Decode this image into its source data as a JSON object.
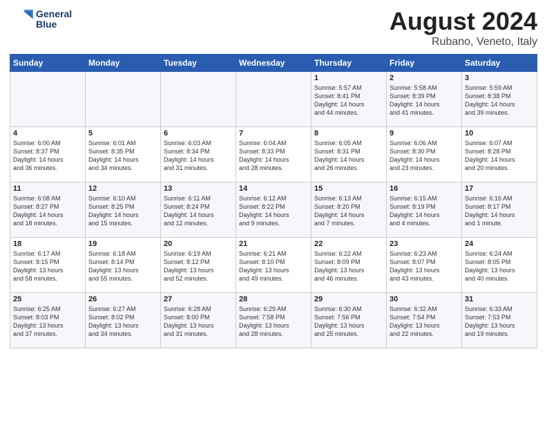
{
  "header": {
    "logo_line1": "General",
    "logo_line2": "Blue",
    "title": "August 2024",
    "subtitle": "Rubano, Veneto, Italy"
  },
  "days_of_week": [
    "Sunday",
    "Monday",
    "Tuesday",
    "Wednesday",
    "Thursday",
    "Friday",
    "Saturday"
  ],
  "weeks": [
    [
      {
        "day": "",
        "info": ""
      },
      {
        "day": "",
        "info": ""
      },
      {
        "day": "",
        "info": ""
      },
      {
        "day": "",
        "info": ""
      },
      {
        "day": "1",
        "info": "Sunrise: 5:57 AM\nSunset: 8:41 PM\nDaylight: 14 hours\nand 44 minutes."
      },
      {
        "day": "2",
        "info": "Sunrise: 5:58 AM\nSunset: 8:39 PM\nDaylight: 14 hours\nand 41 minutes."
      },
      {
        "day": "3",
        "info": "Sunrise: 5:59 AM\nSunset: 8:38 PM\nDaylight: 14 hours\nand 39 minutes."
      }
    ],
    [
      {
        "day": "4",
        "info": "Sunrise: 6:00 AM\nSunset: 8:37 PM\nDaylight: 14 hours\nand 36 minutes."
      },
      {
        "day": "5",
        "info": "Sunrise: 6:01 AM\nSunset: 8:35 PM\nDaylight: 14 hours\nand 34 minutes."
      },
      {
        "day": "6",
        "info": "Sunrise: 6:03 AM\nSunset: 8:34 PM\nDaylight: 14 hours\nand 31 minutes."
      },
      {
        "day": "7",
        "info": "Sunrise: 6:04 AM\nSunset: 8:33 PM\nDaylight: 14 hours\nand 28 minutes."
      },
      {
        "day": "8",
        "info": "Sunrise: 6:05 AM\nSunset: 8:31 PM\nDaylight: 14 hours\nand 26 minutes."
      },
      {
        "day": "9",
        "info": "Sunrise: 6:06 AM\nSunset: 8:30 PM\nDaylight: 14 hours\nand 23 minutes."
      },
      {
        "day": "10",
        "info": "Sunrise: 6:07 AM\nSunset: 8:28 PM\nDaylight: 14 hours\nand 20 minutes."
      }
    ],
    [
      {
        "day": "11",
        "info": "Sunrise: 6:08 AM\nSunset: 8:27 PM\nDaylight: 14 hours\nand 18 minutes."
      },
      {
        "day": "12",
        "info": "Sunrise: 6:10 AM\nSunset: 8:25 PM\nDaylight: 14 hours\nand 15 minutes."
      },
      {
        "day": "13",
        "info": "Sunrise: 6:11 AM\nSunset: 8:24 PM\nDaylight: 14 hours\nand 12 minutes."
      },
      {
        "day": "14",
        "info": "Sunrise: 6:12 AM\nSunset: 8:22 PM\nDaylight: 14 hours\nand 9 minutes."
      },
      {
        "day": "15",
        "info": "Sunrise: 6:13 AM\nSunset: 8:20 PM\nDaylight: 14 hours\nand 7 minutes."
      },
      {
        "day": "16",
        "info": "Sunrise: 6:15 AM\nSunset: 8:19 PM\nDaylight: 14 hours\nand 4 minutes."
      },
      {
        "day": "17",
        "info": "Sunrise: 6:16 AM\nSunset: 8:17 PM\nDaylight: 14 hours\nand 1 minute."
      }
    ],
    [
      {
        "day": "18",
        "info": "Sunrise: 6:17 AM\nSunset: 8:15 PM\nDaylight: 13 hours\nand 58 minutes."
      },
      {
        "day": "19",
        "info": "Sunrise: 6:18 AM\nSunset: 8:14 PM\nDaylight: 13 hours\nand 55 minutes."
      },
      {
        "day": "20",
        "info": "Sunrise: 6:19 AM\nSunset: 8:12 PM\nDaylight: 13 hours\nand 52 minutes."
      },
      {
        "day": "21",
        "info": "Sunrise: 6:21 AM\nSunset: 8:10 PM\nDaylight: 13 hours\nand 49 minutes."
      },
      {
        "day": "22",
        "info": "Sunrise: 6:22 AM\nSunset: 8:09 PM\nDaylight: 13 hours\nand 46 minutes."
      },
      {
        "day": "23",
        "info": "Sunrise: 6:23 AM\nSunset: 8:07 PM\nDaylight: 13 hours\nand 43 minutes."
      },
      {
        "day": "24",
        "info": "Sunrise: 6:24 AM\nSunset: 8:05 PM\nDaylight: 13 hours\nand 40 minutes."
      }
    ],
    [
      {
        "day": "25",
        "info": "Sunrise: 6:25 AM\nSunset: 8:03 PM\nDaylight: 13 hours\nand 37 minutes."
      },
      {
        "day": "26",
        "info": "Sunrise: 6:27 AM\nSunset: 8:02 PM\nDaylight: 13 hours\nand 34 minutes."
      },
      {
        "day": "27",
        "info": "Sunrise: 6:28 AM\nSunset: 8:00 PM\nDaylight: 13 hours\nand 31 minutes."
      },
      {
        "day": "28",
        "info": "Sunrise: 6:29 AM\nSunset: 7:58 PM\nDaylight: 13 hours\nand 28 minutes."
      },
      {
        "day": "29",
        "info": "Sunrise: 6:30 AM\nSunset: 7:56 PM\nDaylight: 13 hours\nand 25 minutes."
      },
      {
        "day": "30",
        "info": "Sunrise: 6:32 AM\nSunset: 7:54 PM\nDaylight: 13 hours\nand 22 minutes."
      },
      {
        "day": "31",
        "info": "Sunrise: 6:33 AM\nSunset: 7:53 PM\nDaylight: 13 hours\nand 19 minutes."
      }
    ]
  ]
}
